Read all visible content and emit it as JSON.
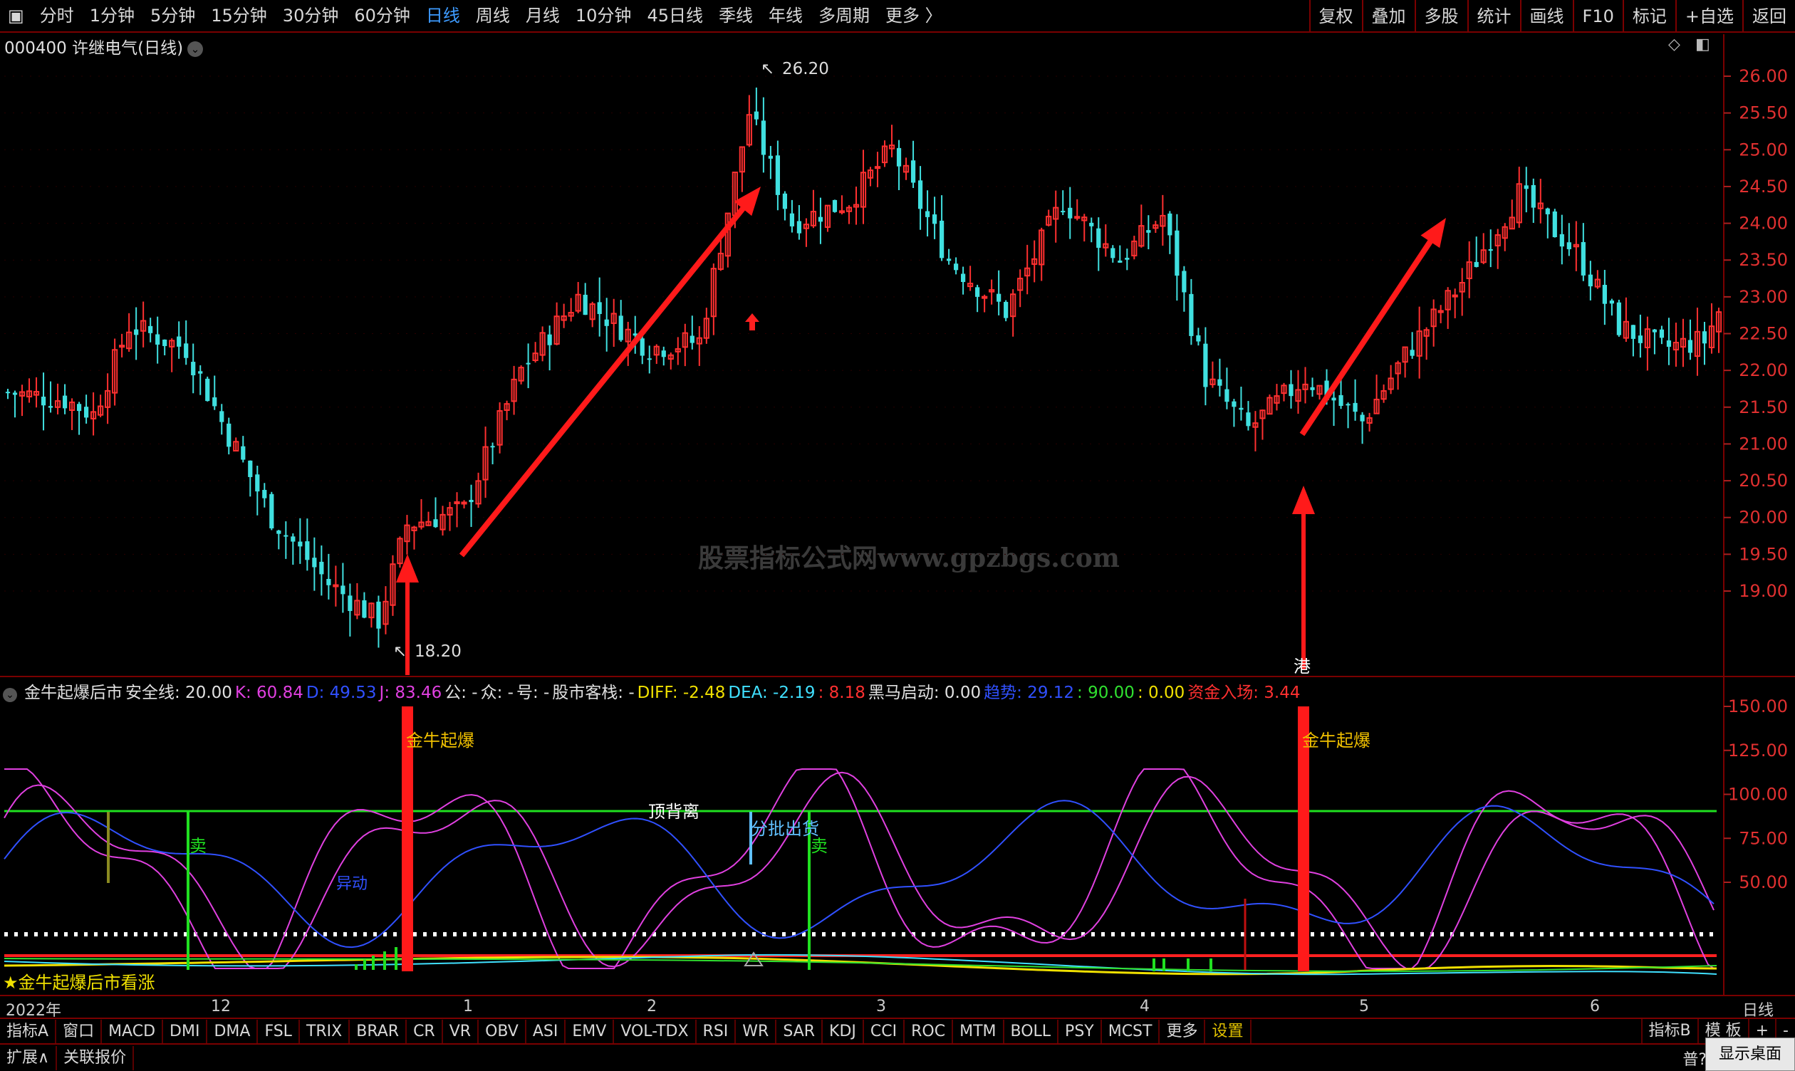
{
  "topbar": {
    "left": [
      "▣",
      "分时",
      "1分钟",
      "5分钟",
      "15分钟",
      "30分钟",
      "60分钟",
      "日线",
      "周线",
      "月线",
      "10分钟",
      "45日线",
      "季线",
      "年线",
      "多周期",
      "更多 〉"
    ],
    "active": "日线",
    "right": [
      "复权",
      "叠加",
      "多股",
      "统计",
      "画线",
      "F10",
      "标记",
      "+自选",
      "返回"
    ]
  },
  "stock": {
    "code_name": "000400 许继电气(日线)",
    "dropdown_icon": "chevron-down-icon"
  },
  "price_axis": {
    "labels": [
      "26.00",
      "25.50",
      "25.00",
      "24.50",
      "24.00",
      "23.50",
      "23.00",
      "22.50",
      "22.00",
      "21.50",
      "21.00",
      "20.50",
      "20.00",
      "19.50",
      "19.00"
    ]
  },
  "annotations": {
    "high": "26.20",
    "low": "18.20"
  },
  "indicator": {
    "name": "金牛起爆后市",
    "fields": [
      {
        "label": "安全线: 20.00",
        "color": "#e0e0e0"
      },
      {
        "label": "K: 60.84",
        "color": "#e040e0"
      },
      {
        "label": "D: 49.53",
        "color": "#3050ff"
      },
      {
        "label": "J: 83.46",
        "color": "#e040e0"
      },
      {
        "label": "公: -",
        "color": "#e0e0e0"
      },
      {
        "label": "众: -",
        "color": "#e0e0e0"
      },
      {
        "label": "号: -",
        "color": "#e0e0e0"
      },
      {
        "label": "股市客栈: -",
        "color": "#e0e0e0"
      },
      {
        "label": "DIFF: -2.48",
        "color": "#f0e000"
      },
      {
        "label": "DEA: -2.19",
        "color": "#40e0ff"
      },
      {
        "label": ": 8.18",
        "color": "#ff3030"
      },
      {
        "label": "黑马启动: 0.00",
        "color": "#e0e0e0"
      },
      {
        "label": "趋势: 29.12",
        "color": "#3050ff"
      },
      {
        "label": ": 90.00",
        "color": "#30e030"
      },
      {
        "label": ": 0.00",
        "color": "#f0e000"
      },
      {
        "label": "资金入场: 3.44",
        "color": "#ff3030"
      }
    ],
    "axis": [
      "150.00",
      "125.00",
      "100.00",
      "75.00",
      "50.00"
    ],
    "labels": {
      "qibao": "金牛起爆",
      "beili": "顶背离",
      "chuhuo": "分批出货",
      "mai": "卖",
      "yidong": "异动",
      "gang": "港",
      "kanzhang": "★金牛起爆后市看涨"
    }
  },
  "date_axis": {
    "labels": [
      "2022年",
      "12",
      "1",
      "2",
      "3",
      "4",
      "5",
      "6"
    ],
    "right": "日线"
  },
  "tabs": [
    "指标A",
    "窗口",
    "MACD",
    "DMI",
    "DMA",
    "FSL",
    "TRIX",
    "BRAR",
    "CR",
    "VR",
    "OBV",
    "ASI",
    "EMV",
    "VOL-TDX",
    "RSI",
    "WR",
    "SAR",
    "KDJ",
    "CCI",
    "ROC",
    "MTM",
    "BOLL",
    "PSY",
    "MCST",
    "更多",
    "设置"
  ],
  "tabs_highlight": "设置",
  "tabs_right": [
    "指标B",
    "模 板",
    "+",
    "-"
  ],
  "bottom": [
    "扩展∧",
    "关联报价"
  ],
  "bottom_right": {
    "putong": "普?",
    "show_desktop": "显示桌面"
  },
  "watermark": "股票指标公式网www.gpzbgs.com",
  "colors": {
    "up": "#ff3030",
    "down": "#40e0e0",
    "border": "#7a0000",
    "active": "#3d9bff"
  }
}
